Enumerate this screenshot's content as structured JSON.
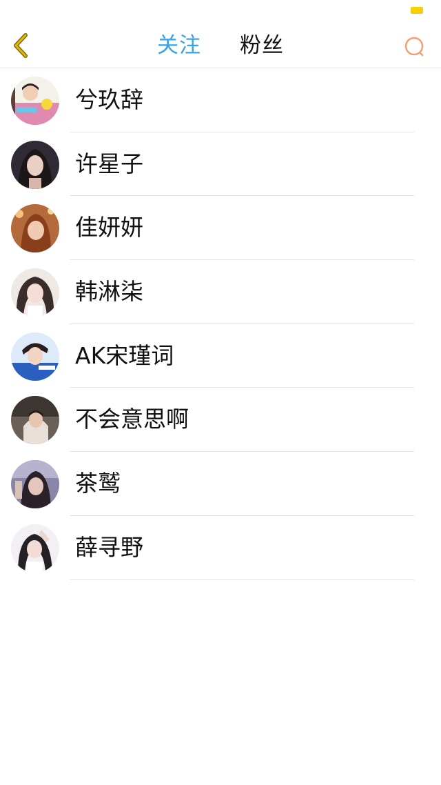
{
  "colors": {
    "accent": "#3aa3e3",
    "battery": "#f5d000",
    "search_icon": "#f0a070",
    "back_icon": "#c8a200"
  },
  "header": {
    "back_icon": "chevron-left-icon",
    "tabs": [
      {
        "label": "关注",
        "active": true
      },
      {
        "label": "粉丝",
        "active": false
      }
    ],
    "search_icon": "search-icon"
  },
  "users": [
    {
      "name": "兮玖辞"
    },
    {
      "name": "许星子"
    },
    {
      "name": "佳妍妍"
    },
    {
      "name": "韩淋柒"
    },
    {
      "name": "AK宋瑾词"
    },
    {
      "name": "不会意思啊"
    },
    {
      "name": "茶鹫"
    },
    {
      "name": "薛寻野"
    }
  ]
}
